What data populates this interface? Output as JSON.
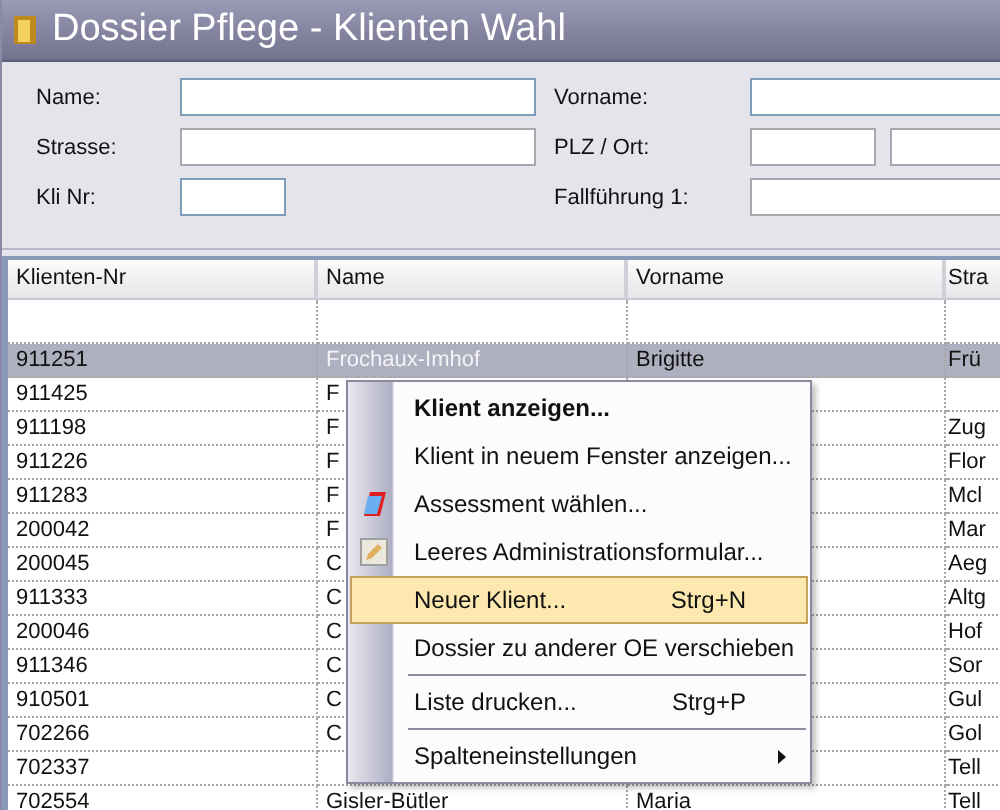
{
  "window": {
    "title": "Dossier Pflege - Klienten Wahl"
  },
  "form": {
    "fields": [
      {
        "label": "Name:",
        "kind": "wide"
      },
      {
        "label": "Vorname:",
        "kind": "wide"
      },
      {
        "label": "Strasse:",
        "kind": "wide"
      },
      {
        "label": "PLZ / Ort:",
        "kind": "split"
      },
      {
        "label": "Kli Nr:",
        "kind": "short"
      },
      {
        "label": "Fallführung 1:",
        "kind": "wide"
      }
    ]
  },
  "table": {
    "columns": [
      "Klienten-Nr",
      "Name",
      "Vorname",
      "Stra"
    ],
    "rows": [
      {
        "cells": [
          "911251",
          "Frochaux-Imhof",
          "Brigitte",
          "Frü"
        ],
        "selected": true
      },
      {
        "cells": [
          "911425",
          "F",
          "",
          ""
        ],
        "selected": false
      },
      {
        "cells": [
          "911198",
          "F",
          "",
          "Zug"
        ],
        "selected": false
      },
      {
        "cells": [
          "911226",
          "F",
          "",
          "Flor"
        ],
        "selected": false
      },
      {
        "cells": [
          "911283",
          "F",
          "",
          "Mcl"
        ],
        "selected": false
      },
      {
        "cells": [
          "200042",
          "F",
          "",
          "Mar"
        ],
        "selected": false
      },
      {
        "cells": [
          "200045",
          "C",
          "",
          "Aeg"
        ],
        "selected": false
      },
      {
        "cells": [
          "911333",
          "C",
          "",
          "Altg"
        ],
        "selected": false
      },
      {
        "cells": [
          "200046",
          "C",
          "",
          "Hof"
        ],
        "selected": false
      },
      {
        "cells": [
          "911346",
          "C",
          "",
          "Sor"
        ],
        "selected": false
      },
      {
        "cells": [
          "910501",
          "C",
          "",
          "Gul"
        ],
        "selected": false
      },
      {
        "cells": [
          "702266",
          "C",
          "",
          "Gol"
        ],
        "selected": false
      },
      {
        "cells": [
          "702337",
          "",
          "",
          "Tell"
        ],
        "selected": false
      },
      {
        "cells": [
          "702554",
          "Gisler-Bütler",
          "Maria",
          "Tell"
        ],
        "selected": false
      }
    ]
  },
  "context_menu": {
    "items": [
      {
        "kind": "plain",
        "label": "Klient anzeigen...",
        "bold": true,
        "selected": false
      },
      {
        "kind": "plain",
        "label": "Klient in neuem Fenster anzeigen...",
        "bold": false,
        "selected": false
      },
      {
        "kind": "assessment",
        "label": "Assessment wählen...",
        "bold": false,
        "selected": false
      },
      {
        "kind": "form",
        "label": "Leeres Administrationsformular...",
        "bold": false,
        "selected": false
      },
      {
        "kind": "plain",
        "label": "Neuer Klient...",
        "shortcut": "Strg+N",
        "bold": false,
        "selected": true
      },
      {
        "kind": "plain",
        "label": "Dossier zu anderer OE verschieben",
        "bold": false,
        "selected": false
      },
      {
        "kind": "separator"
      },
      {
        "kind": "plain",
        "label": "Liste drucken...",
        "shortcut": "Strg+P",
        "bold": false,
        "selected": false
      },
      {
        "kind": "separator"
      },
      {
        "kind": "submenu",
        "label": "Spalteneinstellungen",
        "bold": false,
        "selected": false
      }
    ]
  }
}
